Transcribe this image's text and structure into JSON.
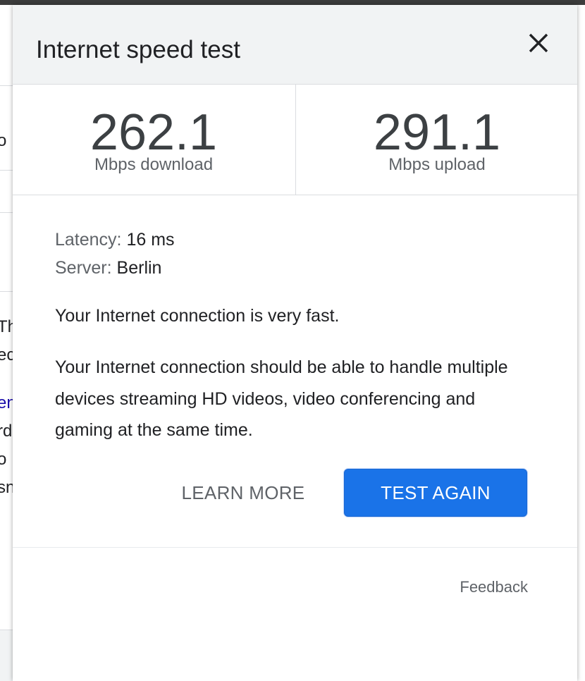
{
  "background": {
    "fragments": [
      "o",
      "Th",
      "ec",
      "en",
      "rd",
      "o",
      "sn"
    ]
  },
  "dialog": {
    "title": "Internet speed test",
    "close_icon": "close-icon",
    "download": {
      "value": "262.1",
      "unit": "Mbps download"
    },
    "upload": {
      "value": "291.1",
      "unit": "Mbps upload"
    },
    "latency": {
      "label": "Latency:",
      "value": "16 ms"
    },
    "server": {
      "label": "Server:",
      "value": "Berlin"
    },
    "verdict": "Your Internet connection is very fast.",
    "description": "Your Internet connection should be able to handle multiple devices streaming HD videos, video conferencing and gaming at the same time.",
    "learn_more_label": "LEARN MORE",
    "test_again_label": "TEST AGAIN",
    "feedback_label": "Feedback"
  },
  "colors": {
    "accent": "#1a73e8",
    "header_bg": "#f1f3f4",
    "text_primary": "#202124",
    "text_secondary": "#5f6368"
  }
}
